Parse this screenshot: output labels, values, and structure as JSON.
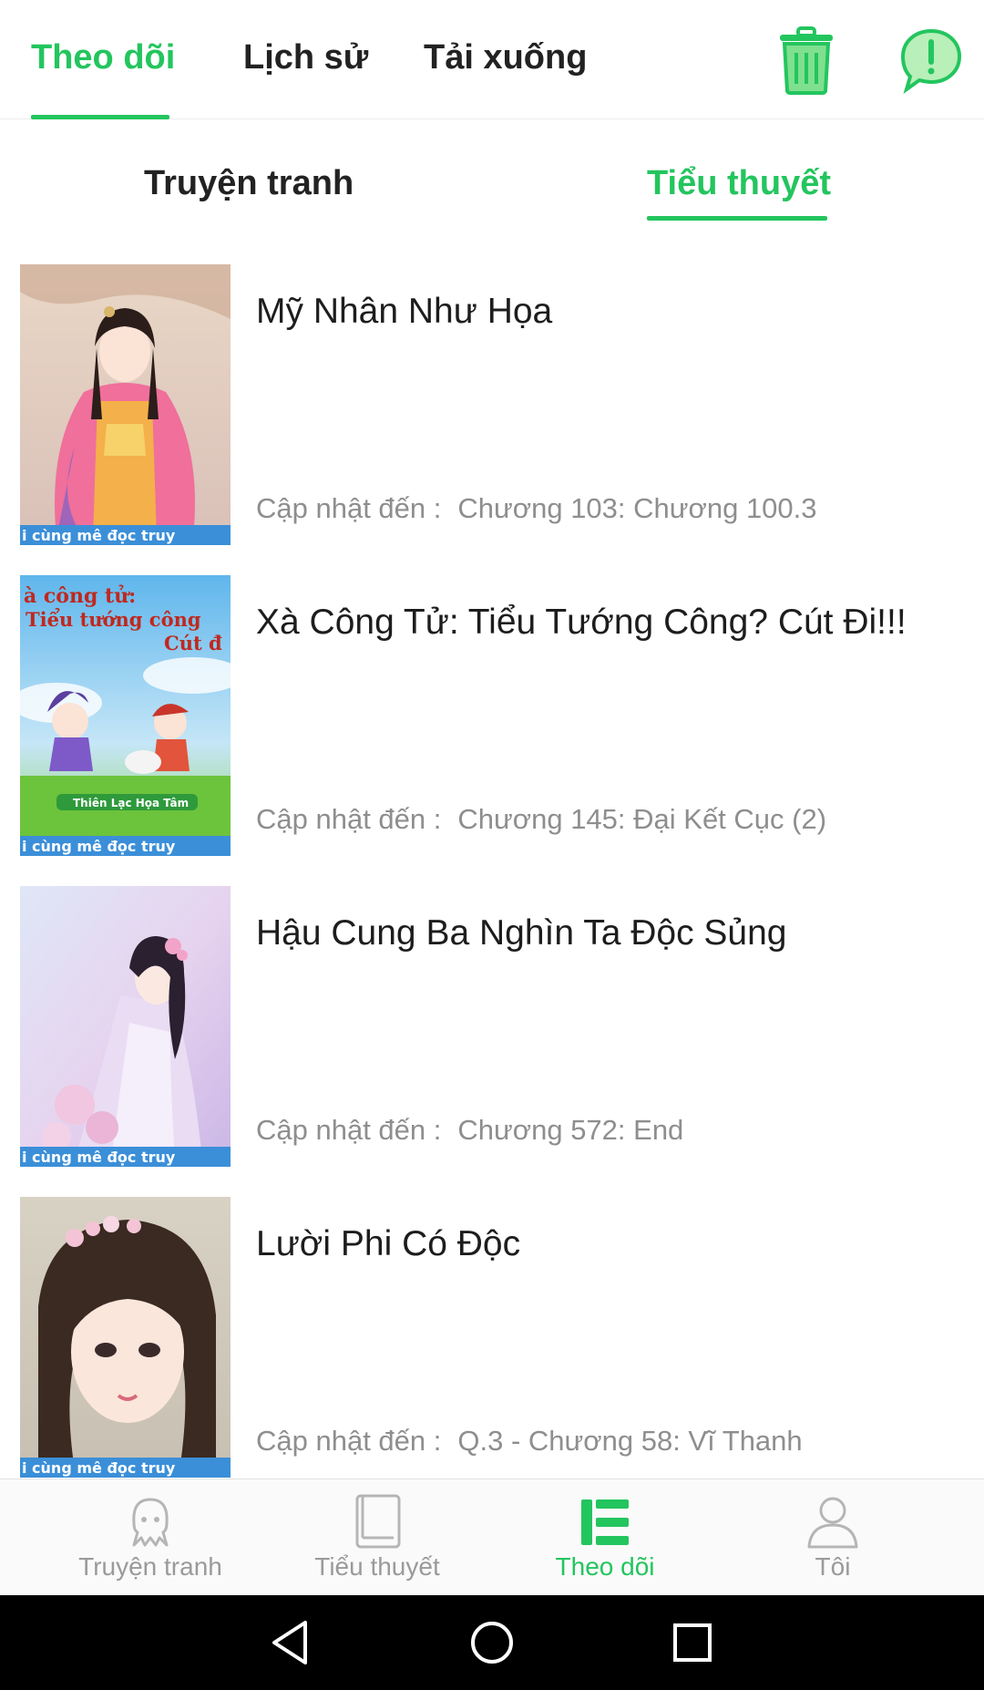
{
  "top_tabs": [
    {
      "label": "Theo dõi",
      "active": true
    },
    {
      "label": "Lịch sử",
      "active": false
    },
    {
      "label": "Tải xuống",
      "active": false
    }
  ],
  "top_actions": {
    "delete_icon": "trash-icon",
    "feedback_icon": "alert-bubble-icon"
  },
  "sub_tabs": [
    {
      "label": "Truyện tranh",
      "active": false
    },
    {
      "label": "Tiểu thuyết",
      "active": true
    }
  ],
  "books": [
    {
      "title": "Mỹ Nhân Như Họa",
      "update_label": "Cập nhật đến :",
      "update_value": "Chương 103: Chương 100.3"
    },
    {
      "title": "Xà Công Tử: Tiểu Tướng Công? Cút Đi!!!",
      "update_label": "Cập nhật đến :",
      "update_value": "Chương 145: Đại Kết Cục (2)"
    },
    {
      "title": "Hậu Cung Ba Nghìn Ta Độc Sủng",
      "update_label": "Cập nhật đến :",
      "update_value": "Chương 572: End"
    },
    {
      "title": "Lười Phi Có Độc",
      "update_label": "Cập nhật đến :",
      "update_value": "Q.3 - Chương 58: Vĩ Thanh"
    }
  ],
  "cover_texts": {
    "banner": "i cùng mê đọc truy",
    "cover2_line1": "à công tử:",
    "cover2_line2": "Tiểu tướng công",
    "cover2_line3": "Cút đ",
    "cover2_footer": "Thiên Lạc Họa Tâm"
  },
  "bottom_nav": [
    {
      "label": "Truyện tranh",
      "icon": "octopus-icon",
      "active": false
    },
    {
      "label": "Tiểu thuyết",
      "icon": "book-icon",
      "active": false
    },
    {
      "label": "Theo dõi",
      "icon": "list-icon",
      "active": true
    },
    {
      "label": "Tôi",
      "icon": "person-icon",
      "active": false
    }
  ],
  "colors": {
    "accent": "#23c55e",
    "text": "#1d1d1d",
    "muted": "#8e8e8e",
    "nav_inactive": "#9a9a9a",
    "system_bar": "#000000"
  }
}
